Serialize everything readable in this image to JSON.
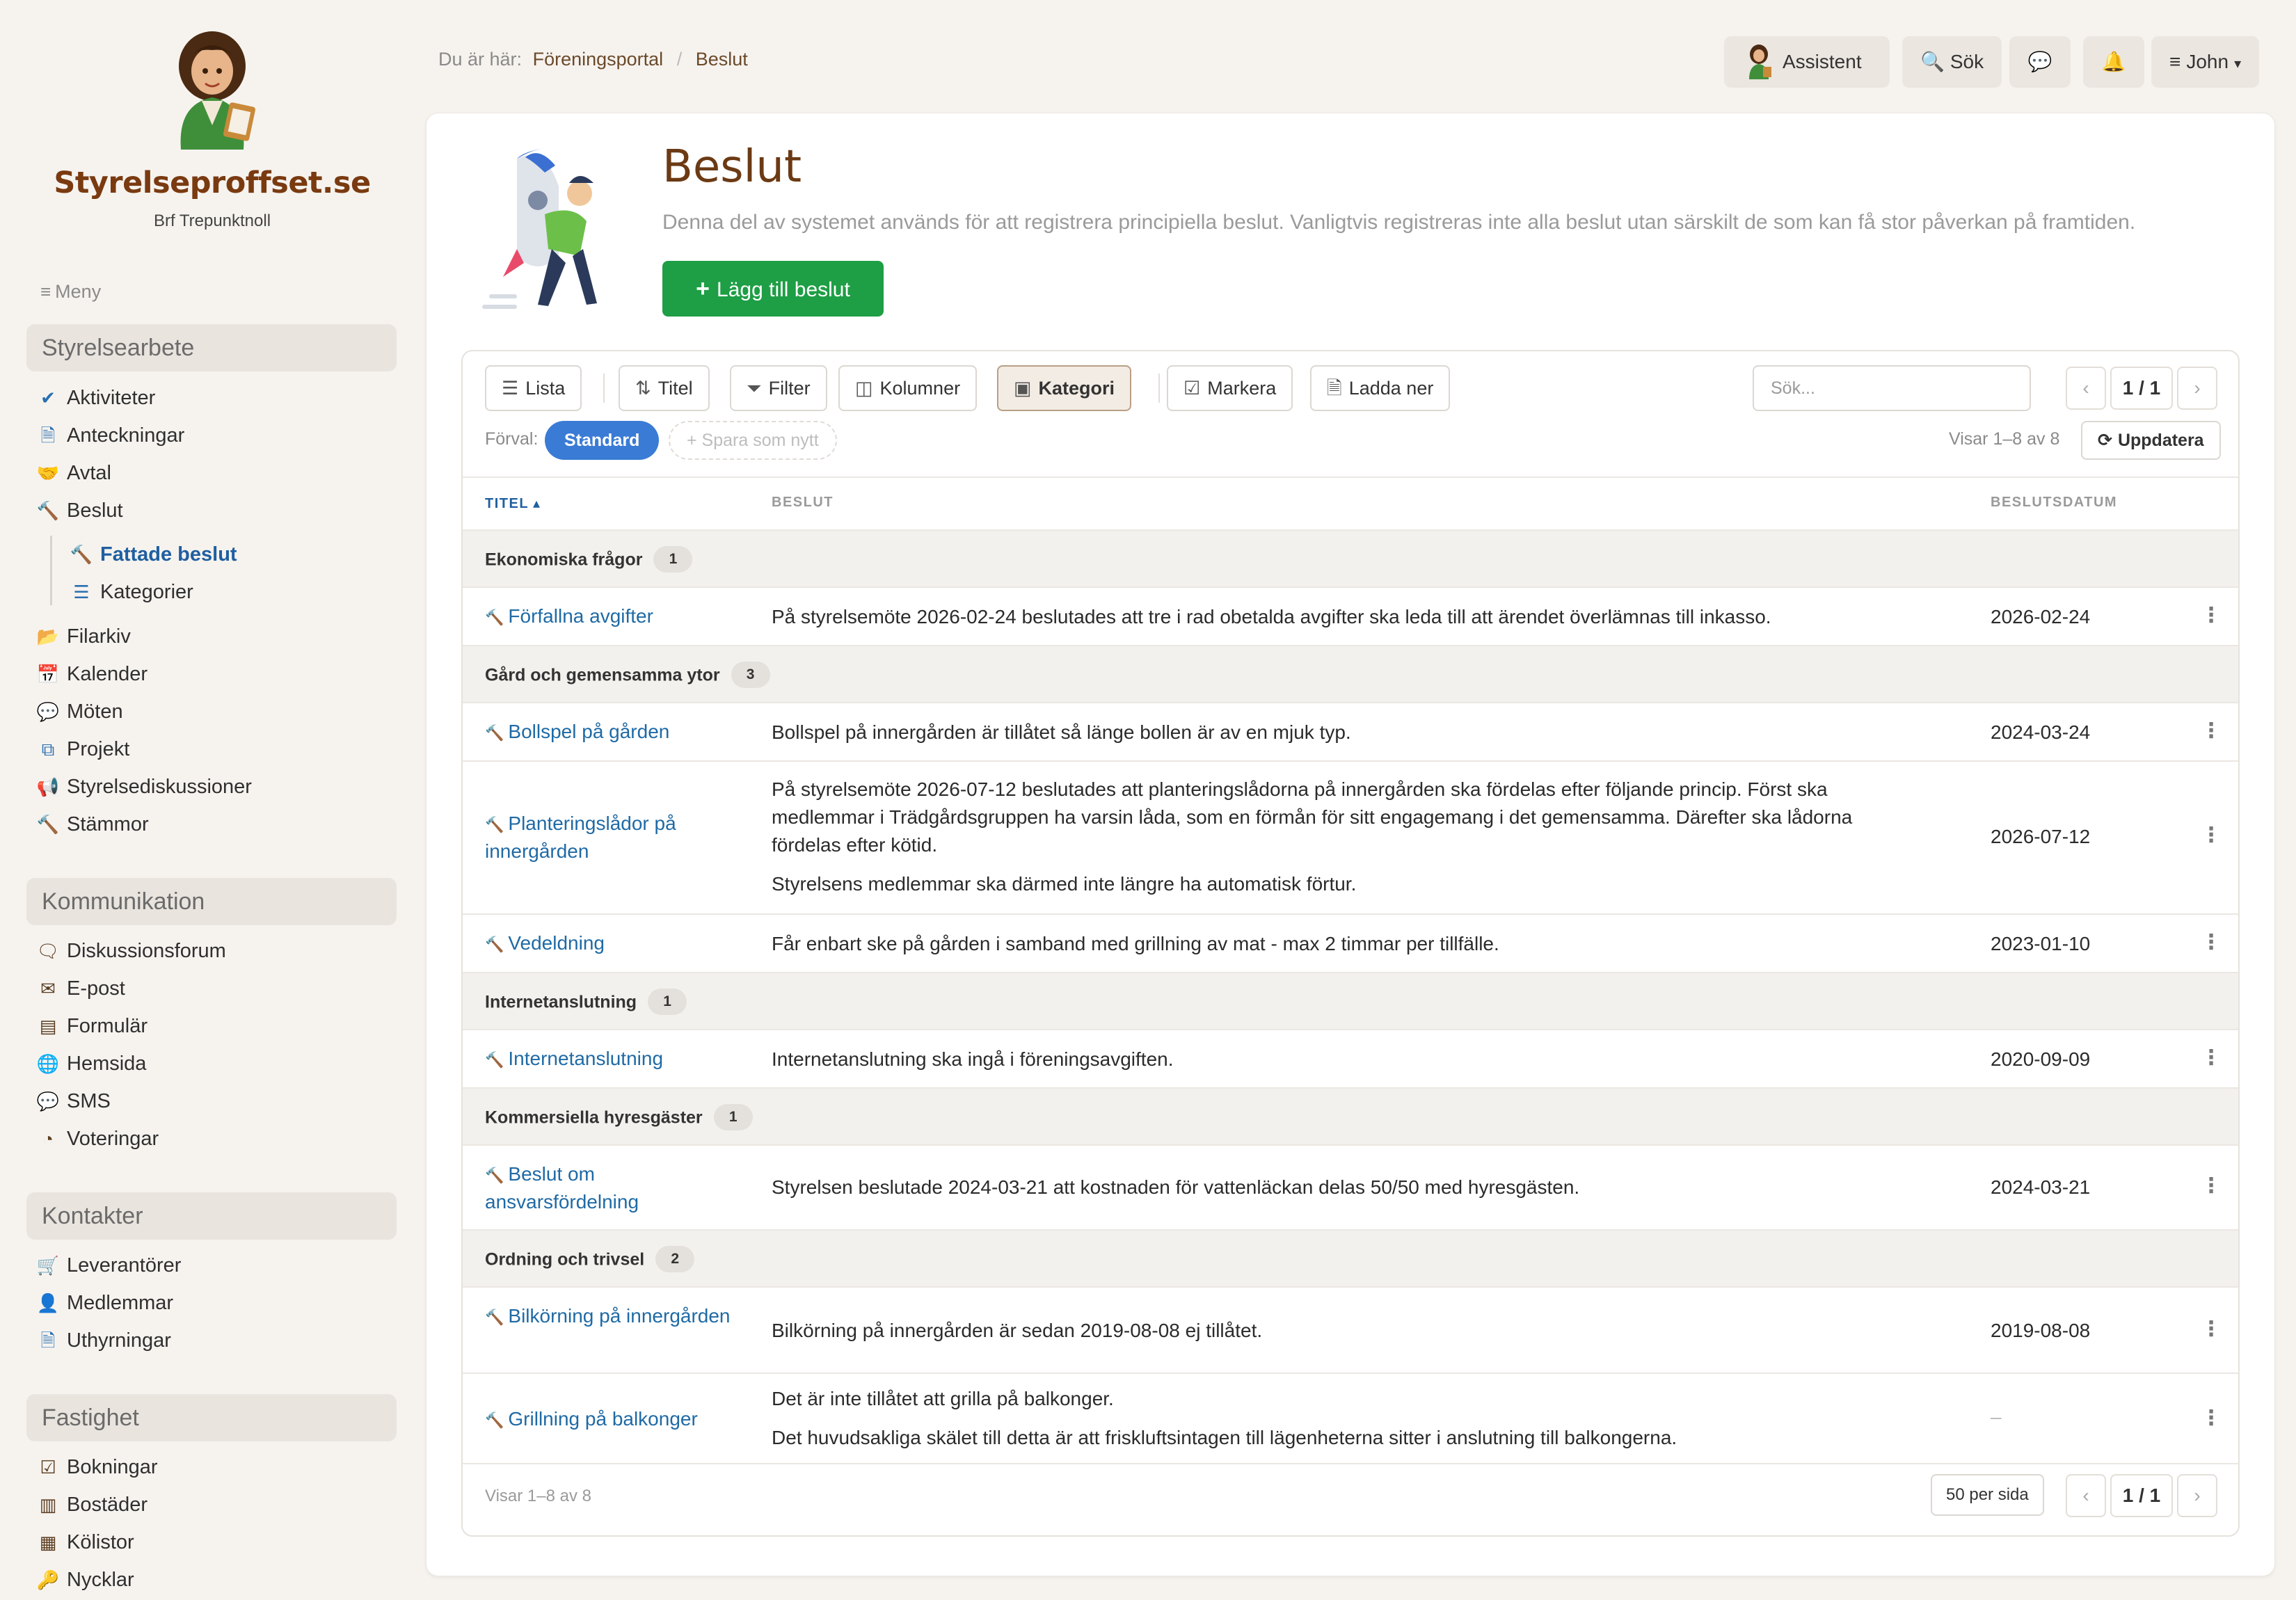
{
  "brand": {
    "name": "Styrelseproffset.se",
    "association": "Brf Trepunktnoll"
  },
  "sidebar": {
    "menu_label": "Meny",
    "sections": [
      {
        "title": "Styrelsearbete",
        "items": [
          {
            "label": "Aktiviteter",
            "icon": "check-icon"
          },
          {
            "label": "Anteckningar",
            "icon": "document-icon"
          },
          {
            "label": "Avtal",
            "icon": "handshake-icon"
          },
          {
            "label": "Beslut",
            "icon": "gavel-icon"
          },
          {
            "label": "Fattade beslut",
            "icon": "gavel-icon",
            "sub": true,
            "active": true
          },
          {
            "label": "Kategorier",
            "icon": "list-icon",
            "sub": true
          },
          {
            "label": "Filarkiv",
            "icon": "folder-icon"
          },
          {
            "label": "Kalender",
            "icon": "calendar-icon"
          },
          {
            "label": "Möten",
            "icon": "chat-bubble-icon"
          },
          {
            "label": "Projekt",
            "icon": "copy-icon"
          },
          {
            "label": "Styrelsediskussioner",
            "icon": "megaphone-icon"
          },
          {
            "label": "Stämmor",
            "icon": "gavel-icon"
          }
        ]
      },
      {
        "title": "Kommunikation",
        "items": [
          {
            "label": "Diskussionsforum",
            "icon": "comments-icon"
          },
          {
            "label": "E-post",
            "icon": "envelope-icon"
          },
          {
            "label": "Formulär",
            "icon": "form-icon"
          },
          {
            "label": "Hemsida",
            "icon": "globe-icon"
          },
          {
            "label": "SMS",
            "icon": "sms-icon"
          },
          {
            "label": "Voteringar",
            "icon": "pie-icon"
          }
        ]
      },
      {
        "title": "Kontakter",
        "items": [
          {
            "label": "Leverantörer",
            "icon": "cart-icon"
          },
          {
            "label": "Medlemmar",
            "icon": "user-icon"
          },
          {
            "label": "Uthyrningar",
            "icon": "document-icon"
          }
        ]
      },
      {
        "title": "Fastighet",
        "items": [
          {
            "label": "Bokningar",
            "icon": "check-square-icon"
          },
          {
            "label": "Bostäder",
            "icon": "building-icon"
          },
          {
            "label": "Kölistor",
            "icon": "list-box-icon"
          },
          {
            "label": "Nycklar",
            "icon": "key-icon"
          }
        ]
      }
    ]
  },
  "breadcrumb": {
    "prefix": "Du är här:",
    "items": [
      "Föreningsportal",
      "Beslut"
    ]
  },
  "topbar": {
    "assistant": "Assistent",
    "search": "Sök",
    "user": "John"
  },
  "page": {
    "title": "Beslut",
    "description": "Denna del av systemet används för att registrera principiella beslut. Vanligtvis registreras inte alla beslut utan särskilt de som kan få stor påverkan på framtiden.",
    "add_button": "Lägg till beslut"
  },
  "toolbar": {
    "lista": "Lista",
    "titel": "Titel",
    "filter": "Filter",
    "kolumner": "Kolumner",
    "kategori": "Kategori",
    "markera": "Markera",
    "ladda_ner": "Ladda ner",
    "search_placeholder": "Sök...",
    "page_indicator": "1 / 1",
    "forval_label": "Förval:",
    "preset_standard": "Standard",
    "preset_save": "+ Spara som nytt",
    "showing": "Visar 1–8 av 8",
    "refresh": "Uppdatera"
  },
  "table": {
    "columns": {
      "titel": "TITEL",
      "beslut": "BESLUT",
      "datum": "BESLUTSDATUM"
    },
    "groups": [
      {
        "name": "Ekonomiska frågor",
        "count": "1",
        "rows": [
          {
            "title": "Förfallna avgifter",
            "text": [
              "På styrelsemöte 2026-02-24 beslutades att tre i rad obetalda avgifter ska leda till att ärendet överlämnas till inkasso."
            ],
            "date": "2026-02-24"
          }
        ]
      },
      {
        "name": "Gård och gemensamma ytor",
        "count": "3",
        "rows": [
          {
            "title": "Bollspel på gården",
            "text": [
              "Bollspel på innergården är tillåtet så länge bollen är av en mjuk typ."
            ],
            "date": "2024-03-24"
          },
          {
            "title": "Planteringslådor på innergården",
            "text": [
              "På styrelsemöte 2026-07-12 beslutades att planteringslådorna på innergården ska fördelas efter följande princip. Först ska medlemmar i Trädgårdsgruppen ha varsin låda, som en förmån för sitt engagemang i det gemensamma. Därefter ska lådorna fördelas efter kötid.",
              "Styrelsens medlemmar ska därmed inte längre ha automatisk förtur."
            ],
            "date": "2026-07-12"
          },
          {
            "title": "Vedeldning",
            "text": [
              "Får enbart ske på gården i samband med grillning av mat - max 2 timmar per tillfälle."
            ],
            "date": "2023-01-10"
          }
        ]
      },
      {
        "name": "Internetanslutning",
        "count": "1",
        "rows": [
          {
            "title": "Internetanslutning",
            "text": [
              "Internetanslutning ska ingå i föreningsavgiften."
            ],
            "date": "2020-09-09"
          }
        ]
      },
      {
        "name": "Kommersiella hyresgäster",
        "count": "1",
        "rows": [
          {
            "title": "Beslut om ansvarsfördelning",
            "text": [
              "Styrelsen beslutade 2024-03-21 att kostnaden för vattenläckan delas 50/50 med hyresgästen."
            ],
            "date": "2024-03-21"
          }
        ]
      },
      {
        "name": "Ordning och trivsel",
        "count": "2",
        "rows": [
          {
            "title": "Bilkörning på innergården",
            "text": [
              "Bilkörning på innergården är sedan 2019-08-08 ej tillåtet."
            ],
            "date": "2019-08-08"
          },
          {
            "title": "Grillning på balkonger",
            "text": [
              "Det är inte tillåtet att grilla på balkonger.",
              "Det huvudsakliga skälet till detta är att friskluftsintagen till lägenheterna sitter i anslutning till balkongerna."
            ],
            "date": "–"
          }
        ]
      }
    ]
  },
  "footer": {
    "showing": "Visar 1–8 av 8",
    "per_page": "50 per sida",
    "page_indicator": "1 / 1"
  },
  "colors": {
    "brand": "#7a3a10",
    "link": "#1f6aa5",
    "primary_button": "#1e9e45",
    "preset_active": "#3a7bd5"
  }
}
